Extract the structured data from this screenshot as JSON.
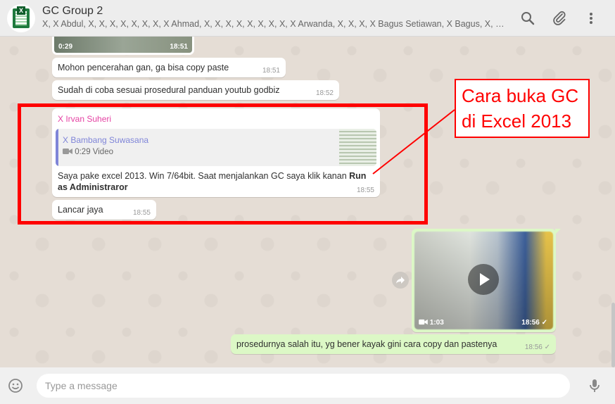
{
  "header": {
    "title": "GC Group 2",
    "members": "X, X Abdul, X, X, X, X, X, X, X, X Ahmad, X, X, X, X, X, X, X, X, X Arwanda, X, X, X, X Bagus Setiawan, X Bagus, X, X, X Budi, X, X, X, …",
    "avatar_icon": "excel-group-avatar",
    "icons": [
      "search-icon",
      "attach-icon",
      "menu-icon"
    ]
  },
  "messages": {
    "video_top": {
      "duration": "0:29",
      "time": "18:51"
    },
    "m1": {
      "text": "Mohon pencerahan gan, ga bisa copy paste",
      "time": "18:51"
    },
    "m2": {
      "text": "Sudah di coba sesuai prosedural panduan youtub godbiz",
      "time": "18:52"
    },
    "m3": {
      "sender": "X Irvan Suheri",
      "quote_name": "X Bambang Suwasana",
      "quote_info": "0:29 Video",
      "text_plain": "Saya pake excel 2013. Win 7/64bit. Saat menjalankan GC saya klik kanan ",
      "text_bold": "Run as Administraror",
      "time": "18:55"
    },
    "m4": {
      "text": "Lancar jaya",
      "time": "18:55"
    },
    "video_out": {
      "duration": "1:03",
      "time": "18:56 ✓"
    },
    "m5": {
      "text": "prosedurnya salah itu, yg bener kayak gini cara copy dan pastenya",
      "time": "18:56 ✓"
    }
  },
  "annotation": {
    "line1": "Cara buka GC",
    "line2": "di Excel 2013",
    "color": "#ff0000"
  },
  "composer": {
    "placeholder": "Type a message",
    "icons": [
      "emoji-icon",
      "mic-icon"
    ]
  },
  "colors": {
    "outgoing": "#dcf8c6",
    "incoming": "#ffffff",
    "sender": "#e542a3",
    "quote": "#7f85d8"
  }
}
